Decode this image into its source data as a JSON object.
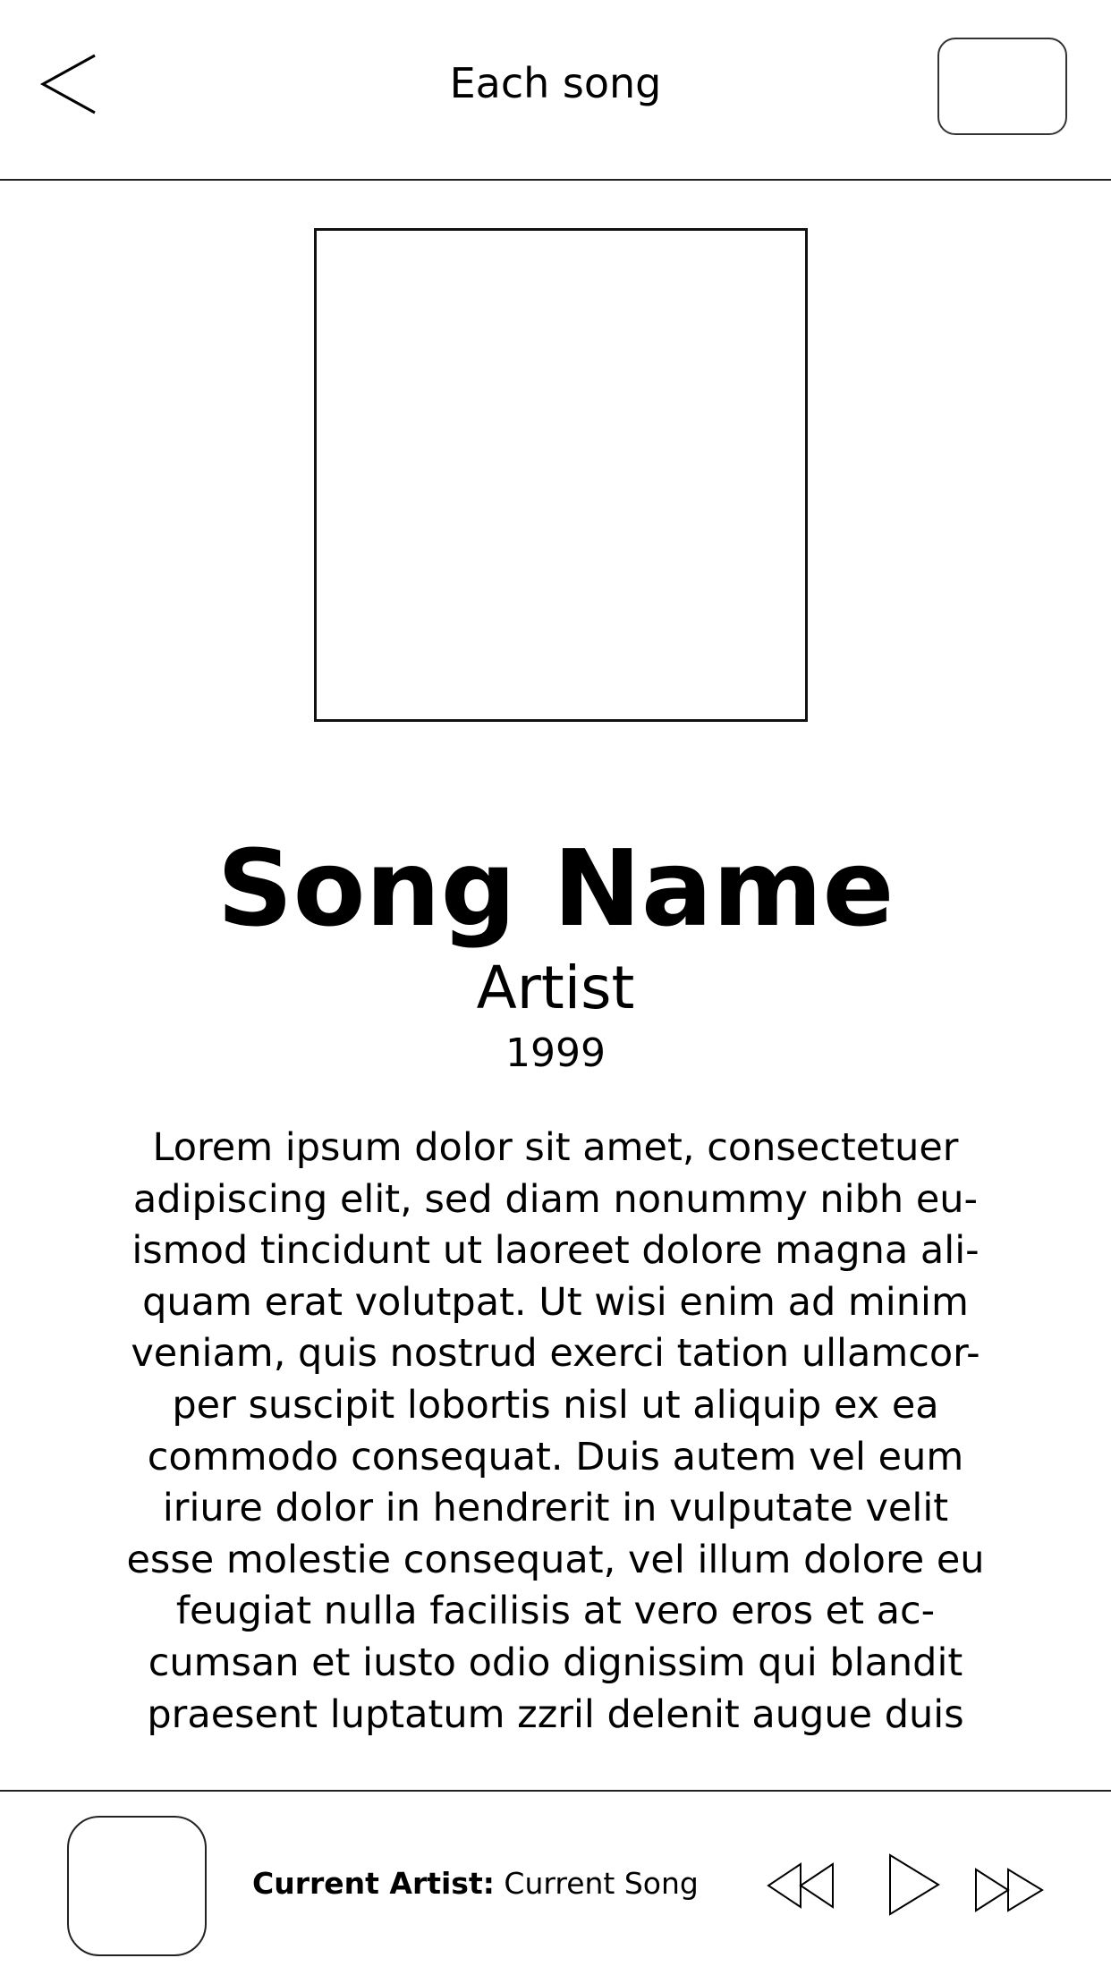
{
  "header": {
    "title": "Each song"
  },
  "song": {
    "name": "Song Name",
    "artist": "Artist",
    "year": "1999",
    "description_lines": [
      "Lorem ipsum dolor sit amet, consectetuer",
      "adipiscing elit, sed diam nonummy nibh eu-",
      "ismod tincidunt ut laoreet dolore magna ali-",
      "quam erat volutpat. Ut wisi enim ad minim",
      "veniam, quis nostrud exerci tation ullamcor-",
      "per suscipit lobortis nisl ut aliquip ex ea",
      "commodo consequat. Duis autem vel eum",
      "iriure dolor in hendrerit in vulputate velit",
      "esse molestie consequat, vel illum dolore eu",
      "feugiat nulla facilisis at vero eros et ac-",
      "cumsan et iusto odio dignissim qui blandit",
      "praesent luptatum zzril delenit augue duis"
    ]
  },
  "player": {
    "artist_label": "Current Artist:",
    "song_label": "Current Song",
    "icons": [
      "rewind-icon",
      "play-icon",
      "fast-forward-icon"
    ]
  }
}
